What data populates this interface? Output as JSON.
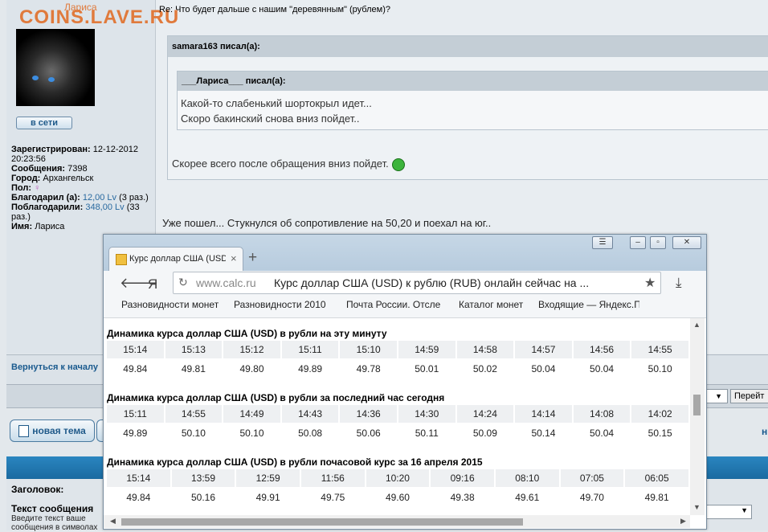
{
  "forum": {
    "logo": "COINS.LAVE.RU",
    "username": "Лариса",
    "online_button": "в сети",
    "post_title": "Re: Что будет дальше с нашим \"деревянным\" (рублем)?",
    "profile": {
      "registered_label": "Зарегистрирован:",
      "registered_value": "12-12-2012 20:23:56",
      "messages_label": "Сообщения:",
      "messages_value": "7398",
      "city_label": "Город:",
      "city_value": "Архангельск",
      "gender_label": "Пол:",
      "gender_icon": "female-icon",
      "thanked_label": "Благодарил (а):",
      "thanked_value": "12,00 Lv",
      "thanked_times": "(3 раз.)",
      "got_thanks_label": "Поблагодарили:",
      "got_thanks_value": "348,00 Lv",
      "got_thanks_times": "(33 раз.)",
      "name_label": "Имя:",
      "name_value": "Лариса"
    },
    "quote_outer_author": "samara163 писал(а):",
    "quote_inner_author": "___Лариса___ писал(а):",
    "quote_inner_line1": "Какой-то слабенький шортокрыл идет...",
    "quote_inner_line2": "Скоро бакинский снова вниз пойдет..",
    "quote_outer_text": "Скорее всего после обращения вниз пойдет.",
    "reply_text": "Уже пошел... Стукнулся об сопротивление на 50,20 и поехал на юг..",
    "back_link": "Вернуться к началу",
    "go_button": "Перейт",
    "new_topic_button": "новая тема",
    "nav_fragment": "н",
    "form_title_label": "Заголовок:",
    "form_message_label": "Текст сообщения",
    "form_hint_line1": "Введите текст ваше",
    "form_hint_line2": "сообщения в символах"
  },
  "browser": {
    "tab_title": "Курс доллар США (USD",
    "tab_close": "×",
    "new_tab": "+",
    "address_host": "www.calc.ru",
    "address_title": "Курс доллар США (USD) к рублю (RUB) онлайн сейчас на ...",
    "bookmarks": [
      "Разновидности монет",
      "Разновидности 2010",
      "Почта России. Отсле",
      "Каталог монет",
      "Входящие — Яндекс.П"
    ],
    "section1": {
      "title": "Динамика курса доллар США (USD) в рубли на эту минуту",
      "times": [
        "15:14",
        "15:13",
        "15:12",
        "15:11",
        "15:10",
        "14:59",
        "14:58",
        "14:57",
        "14:56",
        "14:55"
      ],
      "values": [
        "49.84",
        "49.81",
        "49.80",
        "49.89",
        "49.78",
        "50.01",
        "50.02",
        "50.04",
        "50.04",
        "50.10"
      ]
    },
    "section2": {
      "title": "Динамика курса доллар США (USD) в рубли за последний час сегодня",
      "times": [
        "15:11",
        "14:55",
        "14:49",
        "14:43",
        "14:36",
        "14:30",
        "14:24",
        "14:14",
        "14:08",
        "14:02"
      ],
      "values": [
        "49.89",
        "50.10",
        "50.10",
        "50.08",
        "50.06",
        "50.11",
        "50.09",
        "50.14",
        "50.04",
        "50.15"
      ]
    },
    "section3": {
      "title": "Динамика курса доллар США (USD) в рубли почасовой курс за 16 апреля 2015",
      "times": [
        "15:14",
        "13:59",
        "12:59",
        "11:56",
        "10:20",
        "09:16",
        "08:10",
        "07:05",
        "06:05"
      ],
      "values": [
        "49.84",
        "50.16",
        "49.91",
        "49.75",
        "49.60",
        "49.38",
        "49.61",
        "49.70",
        "49.81"
      ]
    }
  },
  "colors": {
    "logo": "#e07a3c",
    "link": "#1a5a8e",
    "band": "#1a6aa0"
  }
}
